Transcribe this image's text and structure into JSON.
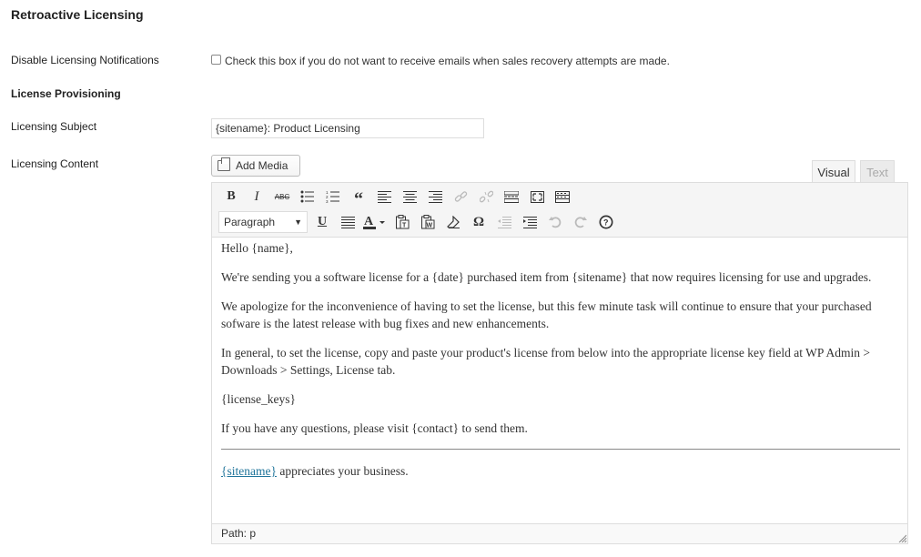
{
  "section": {
    "title": "Retroactive Licensing"
  },
  "fields": {
    "disable_notifications": {
      "label": "Disable Licensing Notifications",
      "checked": false,
      "description": "Check this box if you do not want to receive emails when sales recovery attempts are made."
    },
    "provisioning_heading": "License Provisioning",
    "subject": {
      "label": "Licensing Subject",
      "value": "{sitename}: Product Licensing"
    },
    "content": {
      "label": "Licensing Content"
    }
  },
  "editor": {
    "add_media_label": "Add Media",
    "tabs": {
      "visual": "Visual",
      "text": "Text"
    },
    "format_select": "Paragraph",
    "toolbar_row1": [
      "bold-icon",
      "italic-icon",
      "strikethrough-icon",
      "bullet-list-icon",
      "numbered-list-icon",
      "blockquote-icon",
      "align-left-icon",
      "align-center-icon",
      "align-right-icon",
      "link-icon",
      "unlink-icon",
      "more-tag-icon",
      "fullscreen-icon",
      "kitchen-sink-icon"
    ],
    "toolbar_row2": [
      "format-select",
      "underline-icon",
      "justify-icon",
      "text-color-icon",
      "paste-text-icon",
      "paste-word-icon",
      "clear-format-icon",
      "special-char-icon",
      "outdent-icon",
      "indent-icon",
      "undo-icon",
      "redo-icon",
      "help-icon"
    ],
    "content": {
      "p1": "Hello {name},",
      "p2": "We're sending you a software license for a {date} purchased item from {sitename} that now requires licensing for use and upgrades.",
      "p3": "We apologize for the inconvenience of having to set the license, but this few minute task will continue to ensure that your purchased sofware is the latest release with bug fixes and new enhancements.",
      "p4": "In general, to set the license, copy and paste your product's license from below into the appropriate license key field at WP Admin > Downloads > Settings, License tab.",
      "p5": "{license_keys}",
      "p6": "If you have any questions, please visit {contact} to send them.",
      "closing_link": "{sitename}",
      "closing_text": " appreciates your business."
    },
    "status_path": "Path: p"
  }
}
